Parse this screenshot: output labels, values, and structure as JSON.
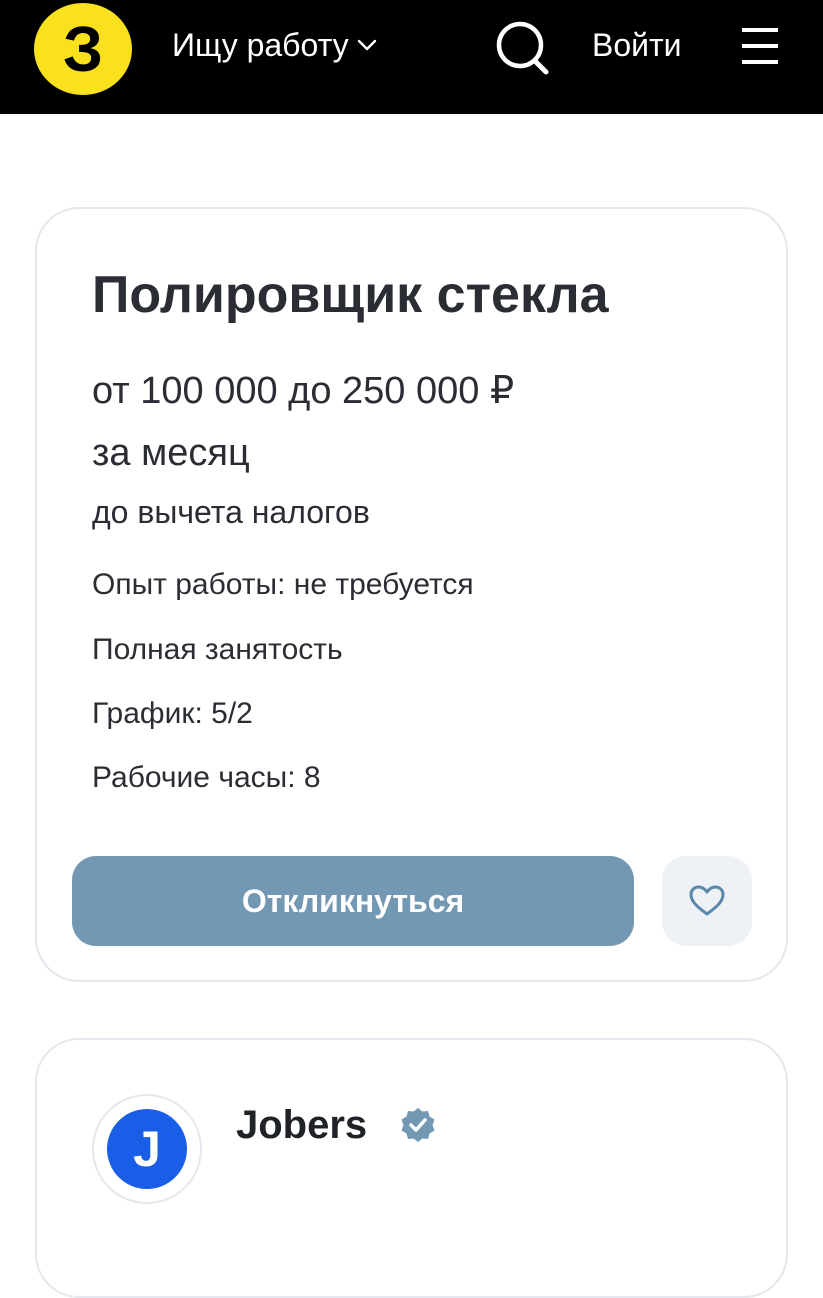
{
  "header": {
    "logo_text": "З",
    "nav_label": "Ищу работу",
    "login_label": "Войти",
    "icons": [
      "chevron-down-icon",
      "search-icon",
      "menu-icon"
    ],
    "bg_color": "#000000",
    "logo_color": "#f9e11e"
  },
  "vacancy": {
    "title": "Полировщик стекла",
    "salary": "от 100 000 до 250 000 ₽",
    "period": "за месяц",
    "tax_note": "до вычета налогов",
    "details": [
      "Опыт работы: не требуется",
      "Полная занятость",
      "График: 5/2",
      "Рабочие часы: 8"
    ],
    "respond_label": "Откликнуться",
    "respond_color": "#7398b4",
    "favorite_icon": "heart-icon"
  },
  "company": {
    "logo_letter": "J",
    "name": "Jobers",
    "verified_icon": "verified-badge-icon",
    "logo_color": "#1a5ee8"
  }
}
